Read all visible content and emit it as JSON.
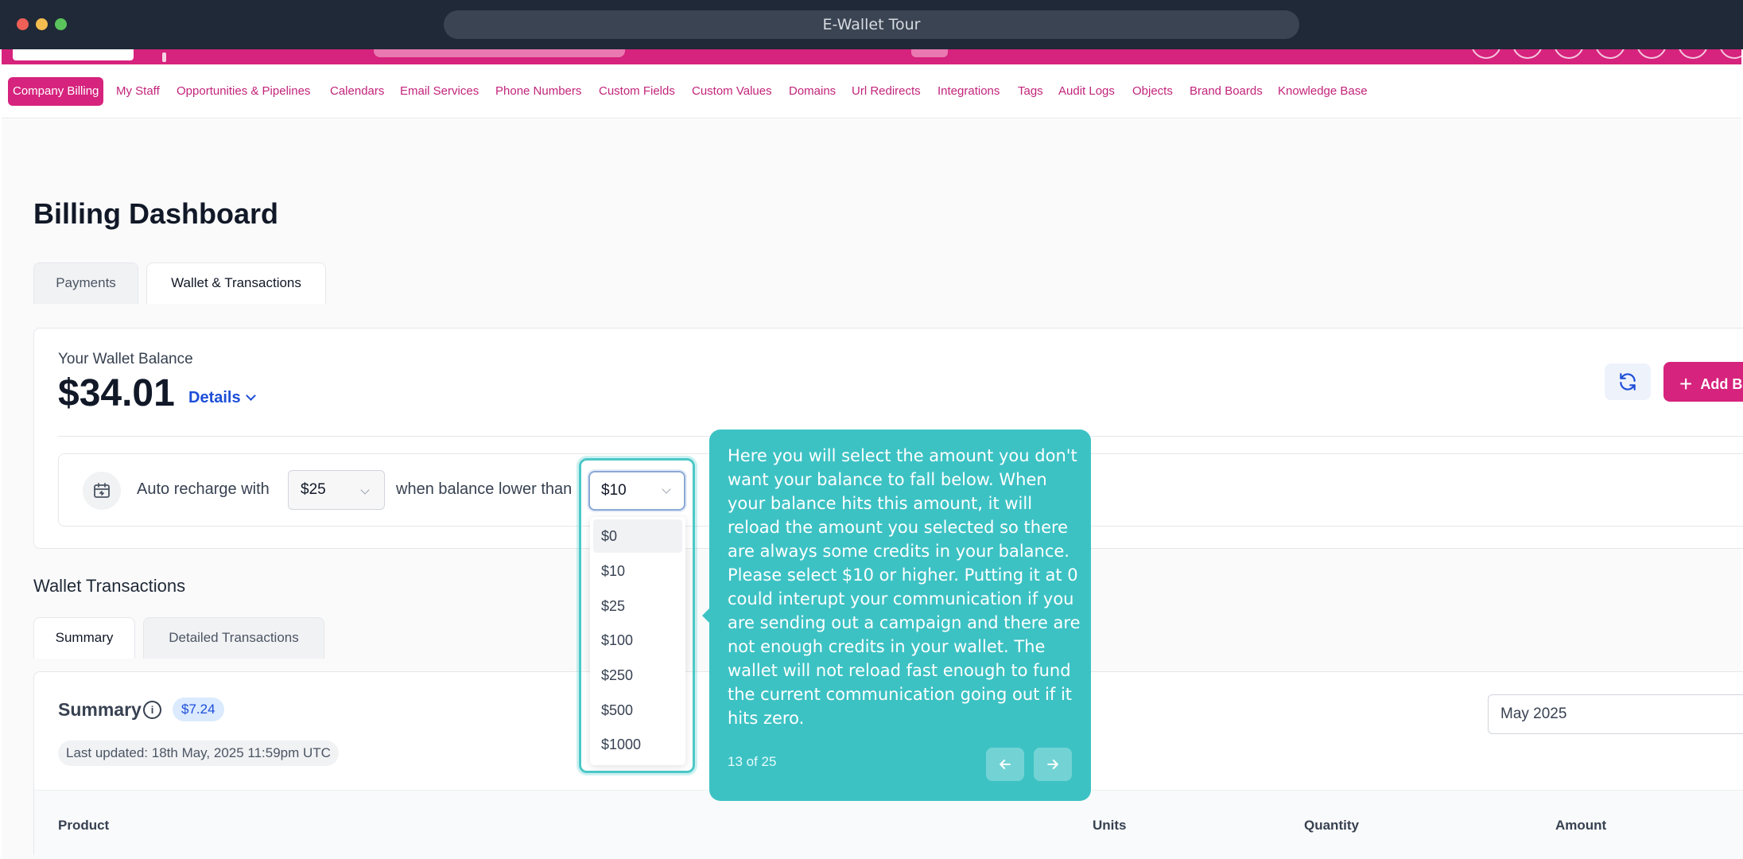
{
  "window": {
    "title": "E-Wallet Tour"
  },
  "nav": {
    "items": [
      "Company Billing",
      "My Staff",
      "Opportunities & Pipelines",
      "Calendars",
      "Email Services",
      "Phone Numbers",
      "Custom Fields",
      "Custom Values",
      "Domains",
      "Url Redirects",
      "Integrations",
      "Tags",
      "Audit Logs",
      "Objects",
      "Brand Boards",
      "Knowledge Base"
    ],
    "active_index": 0
  },
  "page": {
    "title": "Billing Dashboard",
    "tabs": [
      "Payments",
      "Wallet & Transactions"
    ],
    "active_tab": 1
  },
  "wallet": {
    "label": "Your Wallet Balance",
    "amount": "$34.01",
    "details_label": "Details",
    "add_button_label": "Add Ba",
    "auto_recharge": {
      "prefix": "Auto recharge with",
      "recharge_amount": "$25",
      "middle": "when balance lower than",
      "threshold": "$10",
      "threshold_options": [
        "$0",
        "$10",
        "$25",
        "$100",
        "$250",
        "$500",
        "$1000"
      ],
      "hovered_option_index": 0
    }
  },
  "transactions": {
    "title": "Wallet Transactions",
    "tabs": [
      "Summary",
      "Detailed Transactions"
    ],
    "active_tab": 0,
    "summary": {
      "title": "Summary",
      "badge": "$7.24",
      "last_updated": "Last updated: 18th May, 2025 11:59pm UTC",
      "month": "May 2025",
      "columns": [
        "Product",
        "Units",
        "Quantity",
        "Amount"
      ]
    }
  },
  "tour": {
    "text": "Here you will select the amount you don't want your balance to fall below. When your balance hits this amount, it will reload the amount you selected so there are always some credits in your balance. Please select $10 or higher. Putting it at 0 could interupt your communication if you are sending out a campaign and there are not enough credits in your wallet. The wallet will not reload fast enough to fund the current communication going out if it hits zero.",
    "progress": "13 of 25"
  },
  "colors": {
    "brand": "#d6237d",
    "tour": "#3dc2c4",
    "link": "#1d4ed8",
    "titlebar": "#1f2937"
  }
}
